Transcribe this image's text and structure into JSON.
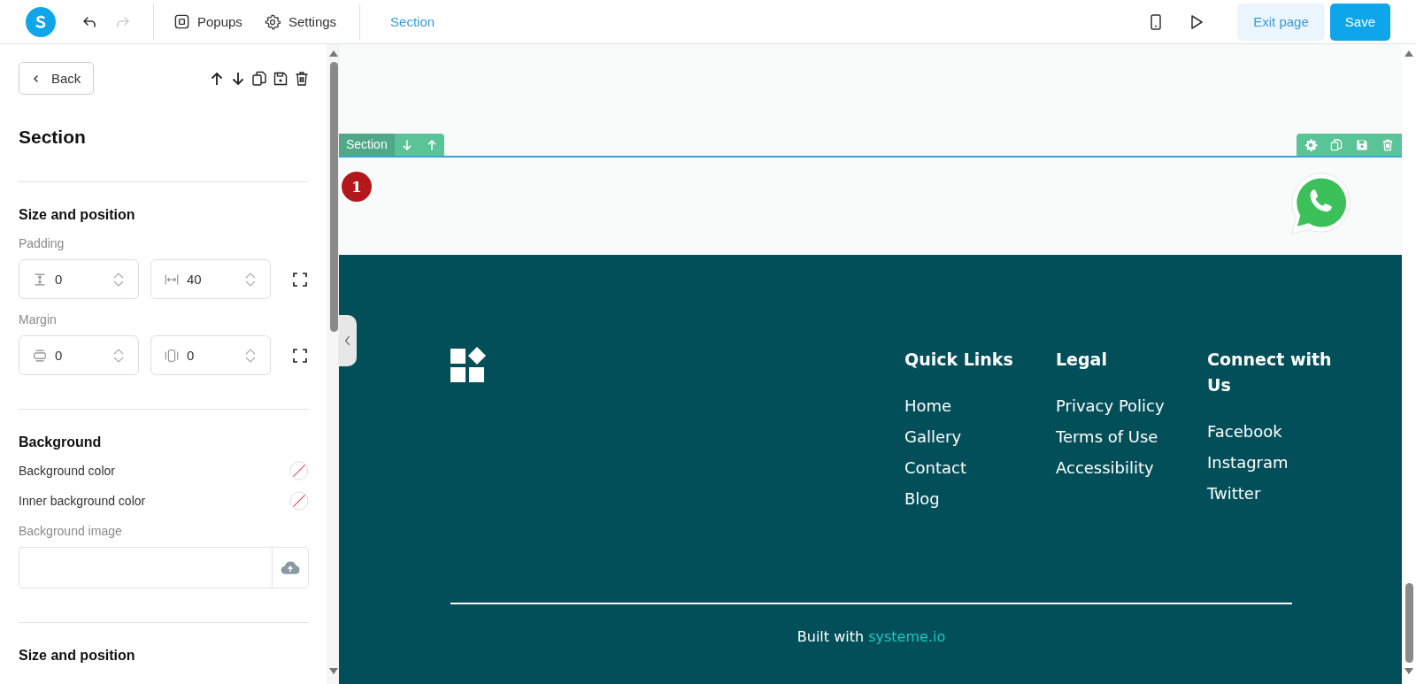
{
  "toolbar": {
    "history": [
      {
        "kind": "undo",
        "disabled": false
      },
      {
        "kind": "redo",
        "disabled": true
      }
    ],
    "menu": [
      {
        "kind": "popups",
        "label": "Popups"
      },
      {
        "kind": "settings",
        "label": "Settings"
      }
    ],
    "breadcrumb": "Section",
    "exit_label": "Exit page",
    "save_label": "Save"
  },
  "panel": {
    "back_label": "Back",
    "title": "Section",
    "size_position": {
      "heading": "Size and position",
      "groups": [
        {
          "label": "Padding",
          "fields": [
            {
              "kind": "padding-vertical",
              "value": "0"
            },
            {
              "kind": "padding-horizontal",
              "value": "40"
            }
          ]
        },
        {
          "label": "Margin",
          "fields": [
            {
              "kind": "margin-vertical",
              "value": "0"
            },
            {
              "kind": "margin-horizontal",
              "value": "0"
            }
          ]
        }
      ]
    },
    "background": {
      "heading": "Background",
      "colors": [
        {
          "label": "Background color"
        },
        {
          "label": "Inner background color"
        }
      ],
      "image_label": "Background image"
    },
    "next_heading": "Size and position"
  },
  "canvas": {
    "section_label": "Section",
    "badge": "1",
    "footer": {
      "columns": [
        {
          "heading": "Quick Links",
          "links": [
            "Home",
            "Gallery",
            "Contact",
            "Blog"
          ]
        },
        {
          "heading": "Legal",
          "links": [
            "Privacy Policy",
            "Terms of Use",
            "Accessibility"
          ]
        },
        {
          "heading": "Connect with Us",
          "links": [
            "Facebook",
            "Instagram",
            "Twitter"
          ]
        }
      ],
      "credit_prefix": "Built with",
      "credit_link": "systeme.io"
    }
  }
}
